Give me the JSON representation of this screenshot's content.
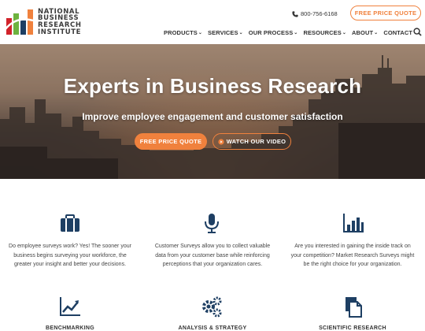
{
  "brand": {
    "logo_lines": [
      "NATIONAL",
      "BUSINESS",
      "RESEARCH",
      "INSTITUTE"
    ],
    "colors": {
      "orange": "#f0813d",
      "navy": "#1e3f63",
      "green": "#6db33f",
      "red": "#d2232a"
    }
  },
  "header": {
    "phone": "800-756-6168",
    "quote_button": "FREE PRICE QUOTE",
    "nav": [
      {
        "label": "PRODUCTS",
        "dropdown": true
      },
      {
        "label": "SERVICES",
        "dropdown": true
      },
      {
        "label": "OUR PROCESS",
        "dropdown": true
      },
      {
        "label": "RESOURCES",
        "dropdown": true
      },
      {
        "label": "ABOUT",
        "dropdown": true
      },
      {
        "label": "CONTACT",
        "dropdown": false
      }
    ]
  },
  "hero": {
    "title": "Experts in Business Research",
    "subtitle": "Improve employee engagement and customer satisfaction",
    "quote_button": "FREE PRICE QUOTE",
    "video_button": "WATCH OUR VIDEO"
  },
  "features": [
    {
      "icon": "briefcase-icon",
      "lines": [
        "Do employee surveys work? Yes! The sooner your",
        "business begins surveying your workforce, the",
        "greater your insight and better your decisions."
      ]
    },
    {
      "icon": "microphone-icon",
      "lines": [
        "Customer Surveys allow you to collect valuable",
        "data from your customer base while reinforcing",
        "perceptions that your organization cares."
      ]
    },
    {
      "icon": "bar-chart-icon",
      "lines": [
        "Are you interested in gaining the inside track on",
        "your competition? Market Research Surveys might",
        "be the right choice for your organization."
      ]
    }
  ],
  "services": [
    {
      "icon": "line-chart-icon",
      "label": "BENCHMARKING"
    },
    {
      "icon": "gears-icon",
      "label": "ANALYSIS & STRATEGY"
    },
    {
      "icon": "documents-icon",
      "label": "SCIENTIFIC RESEARCH"
    }
  ]
}
